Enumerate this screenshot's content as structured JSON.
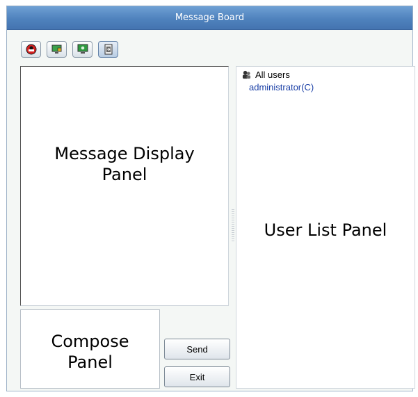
{
  "window": {
    "title": "Message Board"
  },
  "toolbar": {
    "buttons": [
      {
        "icon": "no-entry-icon",
        "active": false
      },
      {
        "icon": "monitor-lock-icon",
        "active": false
      },
      {
        "icon": "monitor-screen-icon",
        "active": false
      },
      {
        "icon": "exit-door-icon",
        "active": true
      }
    ]
  },
  "message_panel": {
    "label_line1": "Message Display",
    "label_line2": "Panel"
  },
  "compose_panel": {
    "label_line1": "Compose",
    "label_line2": "Panel"
  },
  "user_panel": {
    "group_label": "All users",
    "users": [
      "administrator(C)"
    ],
    "label": "User List Panel"
  },
  "buttons": {
    "send": "Send",
    "exit": "Exit"
  },
  "colors": {
    "title_bar": "#4f82bd",
    "user_link": "#1a3fa6",
    "window_bg": "#f4f7f5"
  }
}
